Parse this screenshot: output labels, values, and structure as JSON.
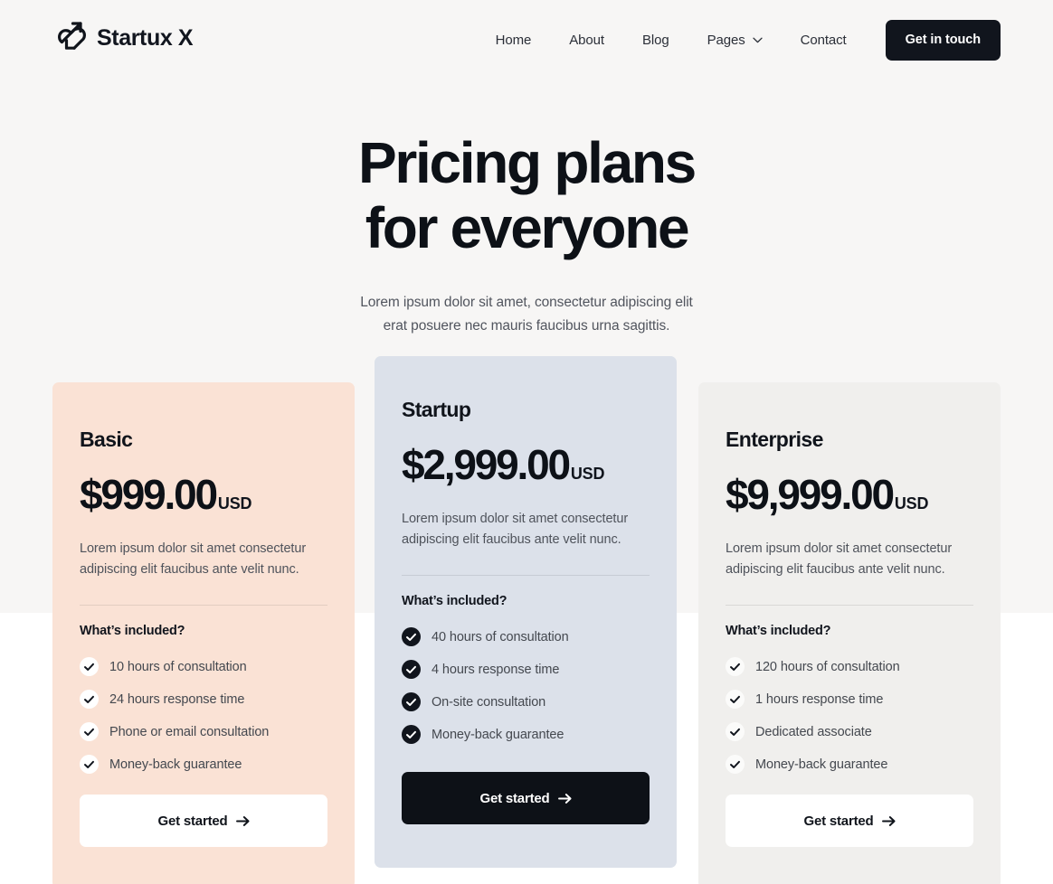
{
  "brand": {
    "name": "Startux X",
    "logo_icon": "arrow-swirl-logo-icon"
  },
  "nav": {
    "items": [
      {
        "label": "Home",
        "icon": null
      },
      {
        "label": "About",
        "icon": null
      },
      {
        "label": "Blog",
        "icon": null
      },
      {
        "label": "Pages",
        "icon": "chevron-down-icon"
      },
      {
        "label": "Contact",
        "icon": null
      }
    ],
    "cta_label": "Get in touch"
  },
  "hero": {
    "title_line1": "Pricing plans",
    "title_line2": "for everyone",
    "sub_line1": "Lorem ipsum dolor sit amet, consectetur adipiscing elit",
    "sub_line2": "erat posuere nec mauris faucibus urna sagittis."
  },
  "colors": {
    "page_bg": "#ffffff",
    "hero_band_bg": "#f7f6f5",
    "basic_bg": "#fae2d5",
    "startup_bg": "#dce1ea",
    "enterprise_bg": "#f0efed",
    "dark": "#0d1117",
    "text_muted": "#4f535b"
  },
  "plans": [
    {
      "name": "Basic",
      "price": "$999.00",
      "currency": "USD",
      "description": "Lorem ipsum dolor sit amet consectetur adipiscing elit faucibus ante velit nunc.",
      "included_title": "What’s included?",
      "check_icon": "check-circle-light-icon",
      "features": [
        "10 hours of consultation",
        "24 hours response time",
        "Phone or email consultation",
        "Money-back guarantee"
      ],
      "button_label": "Get started",
      "button_icon": "arrow-right-icon",
      "button_style": "light",
      "featured": false
    },
    {
      "name": "Startup",
      "price": "$2,999.00",
      "currency": "USD",
      "description": "Lorem ipsum dolor sit amet consectetur adipiscing elit faucibus ante velit nunc.",
      "included_title": "What’s included?",
      "check_icon": "check-circle-dark-icon",
      "features": [
        "40 hours of consultation",
        "4 hours response time",
        "On-site consultation",
        "Money-back guarantee"
      ],
      "button_label": "Get started",
      "button_icon": "arrow-right-icon",
      "button_style": "dark",
      "featured": true
    },
    {
      "name": "Enterprise",
      "price": "$9,999.00",
      "currency": "USD",
      "description": "Lorem ipsum dolor sit amet consectetur adipiscing elit faucibus ante velit nunc.",
      "included_title": "What’s included?",
      "check_icon": "check-circle-light-icon",
      "features": [
        "120 hours of consultation",
        "1 hours response time",
        "Dedicated associate",
        "Money-back guarantee"
      ],
      "button_label": "Get started",
      "button_icon": "arrow-right-icon",
      "button_style": "light",
      "featured": false
    }
  ]
}
